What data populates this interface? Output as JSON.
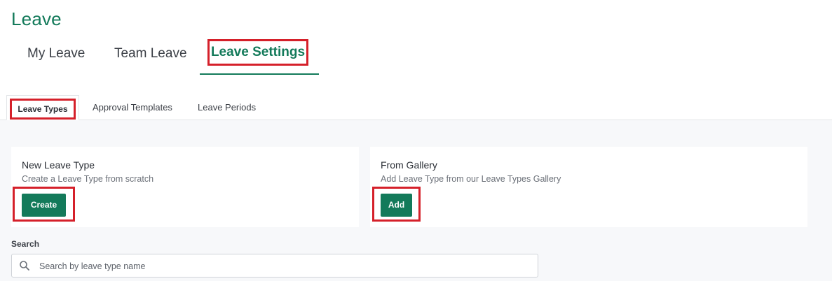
{
  "page": {
    "title": "Leave"
  },
  "top_tabs": [
    {
      "label": "My Leave",
      "active": false
    },
    {
      "label": "Team Leave",
      "active": false
    },
    {
      "label": "Leave Settings",
      "active": true
    }
  ],
  "sub_tabs": [
    {
      "label": "Leave Types",
      "active": true
    },
    {
      "label": "Approval Templates",
      "active": false
    },
    {
      "label": "Leave Periods",
      "active": false
    }
  ],
  "cards": {
    "new_leave_type": {
      "title": "New Leave Type",
      "subtitle": "Create a Leave Type from scratch",
      "button_label": "Create"
    },
    "from_gallery": {
      "title": "From Gallery",
      "subtitle": "Add Leave Type from our Leave Types Gallery",
      "button_label": "Add"
    }
  },
  "search": {
    "label": "Search",
    "placeholder": "Search by leave type name",
    "value": ""
  },
  "colors": {
    "accent": "#137a5a",
    "highlight": "#d5202a",
    "panel_bg": "#f7f8fa"
  },
  "icons": {
    "search": "search-icon"
  }
}
